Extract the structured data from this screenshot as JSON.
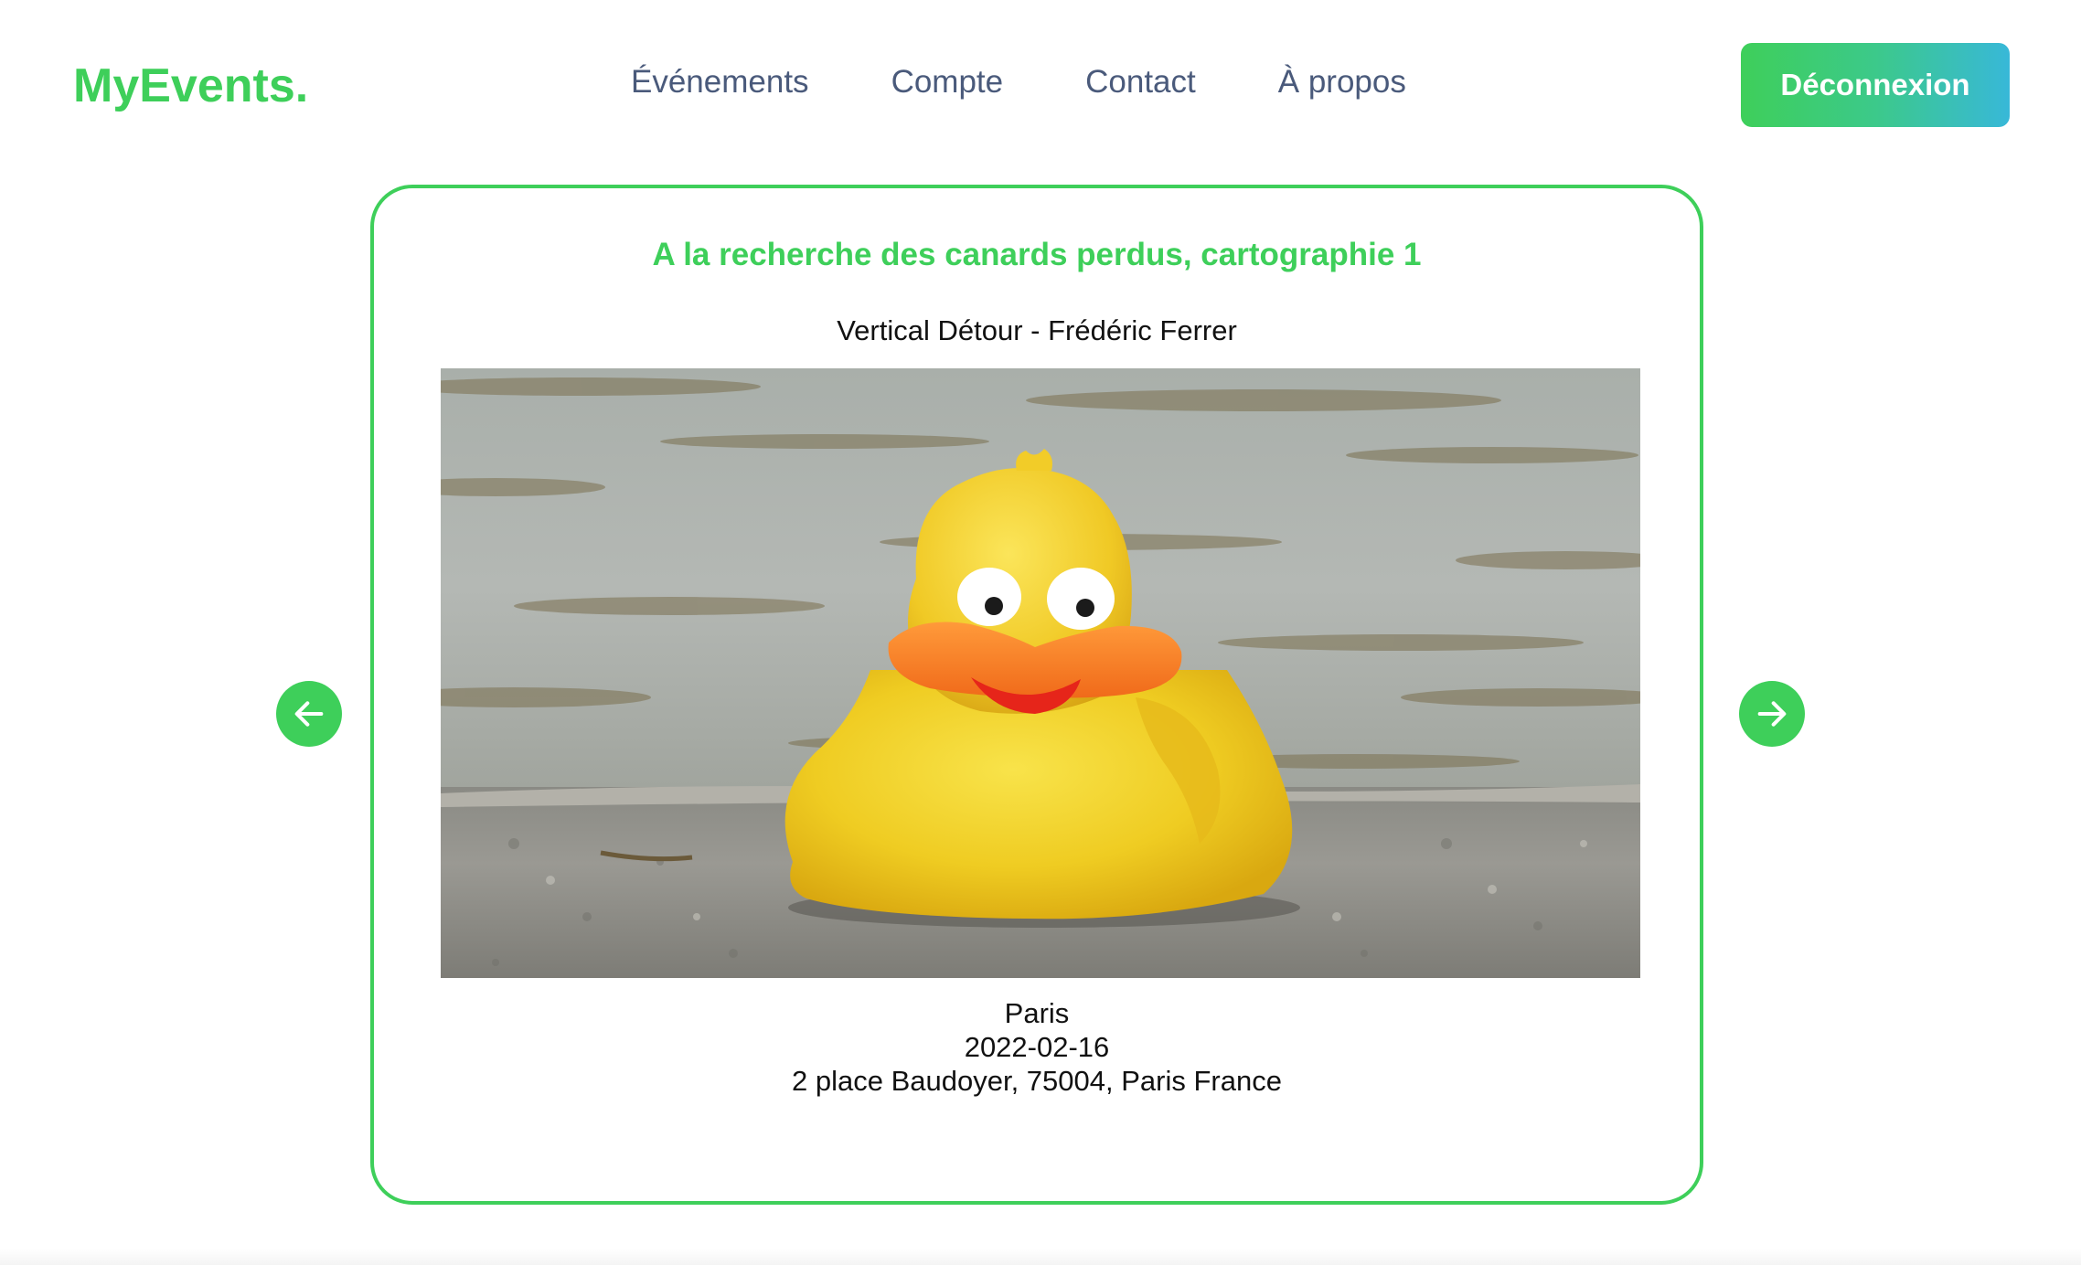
{
  "header": {
    "logo": "MyEvents.",
    "nav": [
      {
        "label": "Événements"
      },
      {
        "label": "Compte"
      },
      {
        "label": "Contact"
      },
      {
        "label": "À propos"
      }
    ],
    "logout_label": "Déconnexion"
  },
  "event": {
    "title": "A la recherche des canards perdus, cartographie 1",
    "subtitle": "Vertical Détour - Frédéric Ferrer",
    "city": "Paris",
    "date": "2022-02-16",
    "address": "2 place Baudoyer, 75004, Paris France",
    "image": {
      "subject": "rubber-duck-photo",
      "alt": "Yellow rubber duck on a stone ledge by the water"
    }
  },
  "carousel": {
    "prev_icon": "arrow-left-icon",
    "next_icon": "arrow-right-icon"
  },
  "colors": {
    "brand_green": "#3ecf5a",
    "nav_text": "#4a5a7b",
    "gradient_end": "#38b8d8",
    "body_text": "#111111"
  }
}
